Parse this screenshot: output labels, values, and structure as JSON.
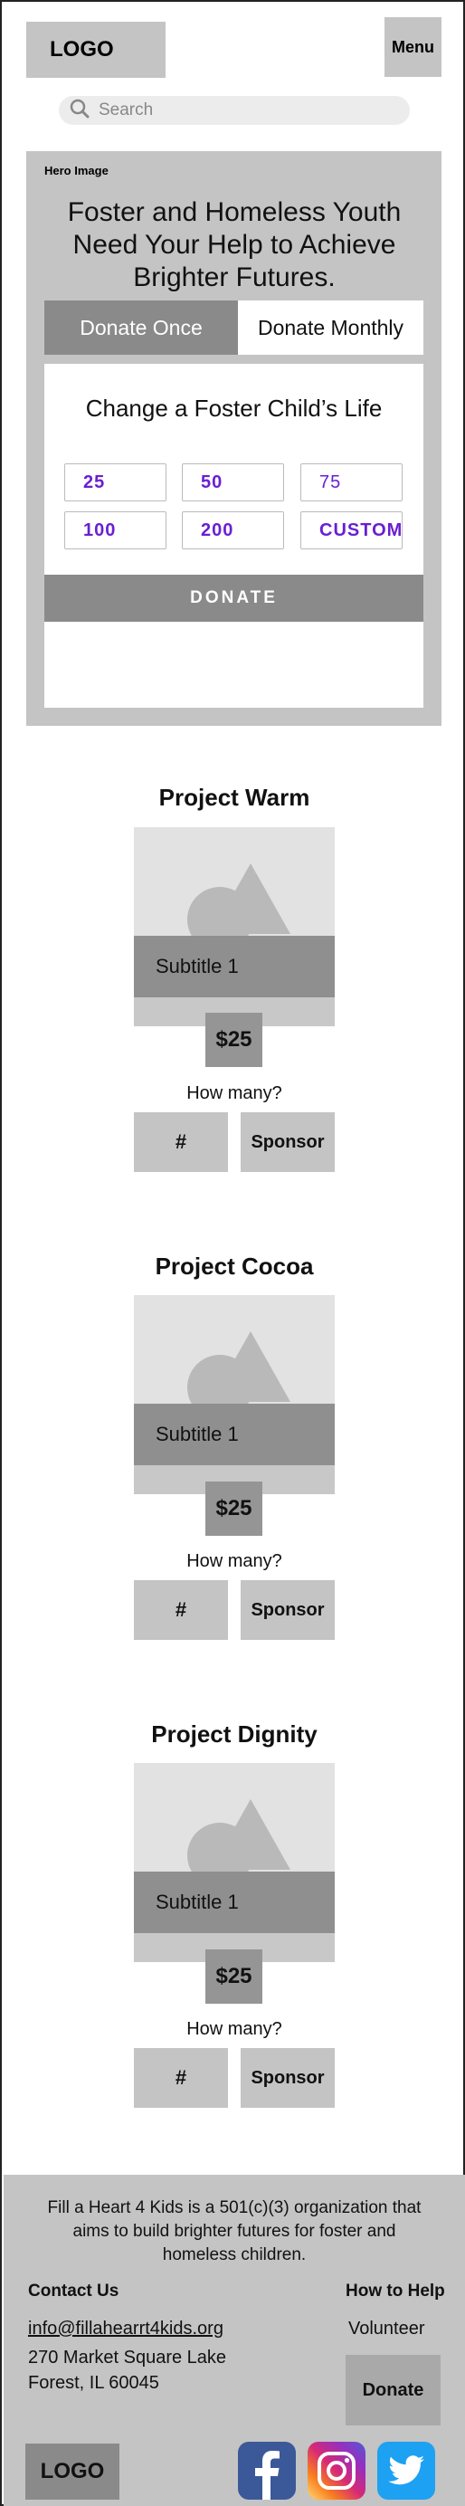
{
  "header": {
    "logo": "LOGO",
    "menu": "Menu",
    "search_placeholder": "Search"
  },
  "hero": {
    "tag": "Hero Image",
    "title": "Foster and Homeless Youth Need Your Help to Achieve Brighter Futures.",
    "toggle": {
      "once": "Donate Once",
      "monthly": "Donate Monthly",
      "selected": "Donate Once"
    },
    "card": {
      "title": "Change a Foster Child’s Life",
      "amounts": [
        "25",
        "50",
        "75",
        "100",
        "200",
        "CUSTOM"
      ],
      "donate": "DONATE"
    }
  },
  "projects": [
    {
      "title": "Project Warm",
      "subtitle": "Subtitle 1",
      "price": "$25",
      "how_many": "How many?",
      "qty": "#",
      "sponsor": "Sponsor"
    },
    {
      "title": "Project Cocoa",
      "subtitle": "Subtitle 1",
      "price": "$25",
      "how_many": "How many?",
      "qty": "#",
      "sponsor": "Sponsor"
    },
    {
      "title": "Project Dignity",
      "subtitle": "Subtitle 1",
      "price": "$25",
      "how_many": "How many?",
      "qty": "#",
      "sponsor": "Sponsor"
    }
  ],
  "footer": {
    "mission": "Fill a Heart 4 Kids is a 501(c)(3) organization that aims to build brighter futures for foster and homeless children.",
    "contact_heading": "Contact Us",
    "email": "info@fillahearrt4kids.org",
    "address": "270 Market Square Lake Forest, IL 60045",
    "help_heading": "How to Help",
    "volunteer": "Volunteer",
    "donate": "Donate",
    "logo": "LOGO",
    "social_icons": [
      "facebook-icon",
      "instagram-icon",
      "twitter-icon"
    ]
  },
  "colors": {
    "placeholder_gray": "#c4c4c4",
    "dark_gray": "#8a8a8a",
    "accent_purple": "#6a1fd1",
    "facebook": "#3b5998",
    "twitter": "#1da1f2"
  }
}
